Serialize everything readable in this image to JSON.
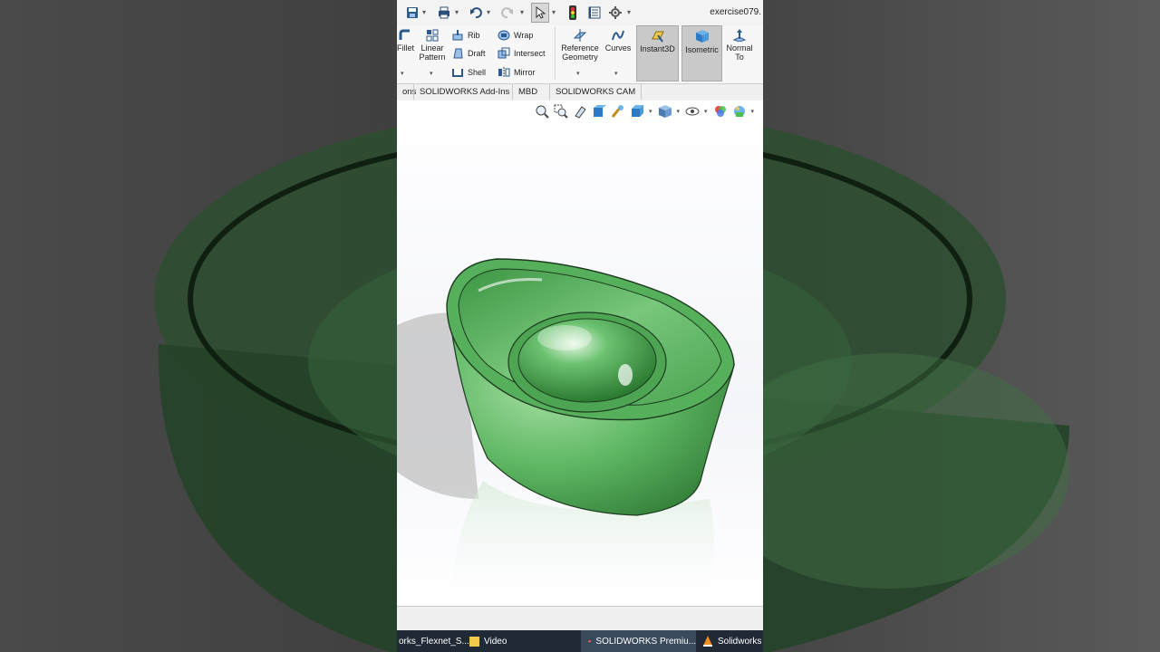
{
  "colors": {
    "part_green": "#5fb864",
    "part_green_dark": "#2f7a35",
    "ribbon_highlight": "#c9c9c9",
    "taskbar": "#1f2a36"
  },
  "title_bar": {
    "document_title": "exercise079.",
    "icons": [
      "save-icon",
      "print-icon",
      "undo-icon",
      "redo-icon",
      "select-icon",
      "rebuild-icon",
      "file-properties-icon",
      "options-icon"
    ]
  },
  "ribbon": {
    "fillet": "Fillet",
    "linear_pattern_line1": "Linear",
    "linear_pattern_line2": "Pattern",
    "rib": "Rib",
    "draft": "Draft",
    "shell": "Shell",
    "wrap": "Wrap",
    "intersect": "Intersect",
    "mirror": "Mirror",
    "reference_geometry_line1": "Reference",
    "reference_geometry_line2": "Geometry",
    "curves": "Curves",
    "instant3d": "Instant3D",
    "isometric": "Isometric",
    "normal_to_line1": "Normal",
    "normal_to_line2": "To"
  },
  "tabs": [
    {
      "label": "ons"
    },
    {
      "label": "SOLIDWORKS Add-Ins"
    },
    {
      "label": "MBD"
    },
    {
      "label": "SOLIDWORKS CAM"
    }
  ],
  "heads_up_toolbar": {
    "icons": [
      "zoom-to-fit-icon",
      "zoom-to-area-icon",
      "previous-view-icon",
      "section-view-icon",
      "dynamic-annotation-icon",
      "view-orientation-icon",
      "display-style-icon",
      "hide-show-items-icon",
      "edit-appearance-icon",
      "apply-scene-icon",
      "view-settings-icon"
    ]
  },
  "taskbar": {
    "items": [
      {
        "label": "orks_Flexnet_S..."
      },
      {
        "label": "Video"
      },
      {
        "label": "SOLIDWORKS Premiu..."
      },
      {
        "label": "Solidworks A"
      }
    ]
  }
}
